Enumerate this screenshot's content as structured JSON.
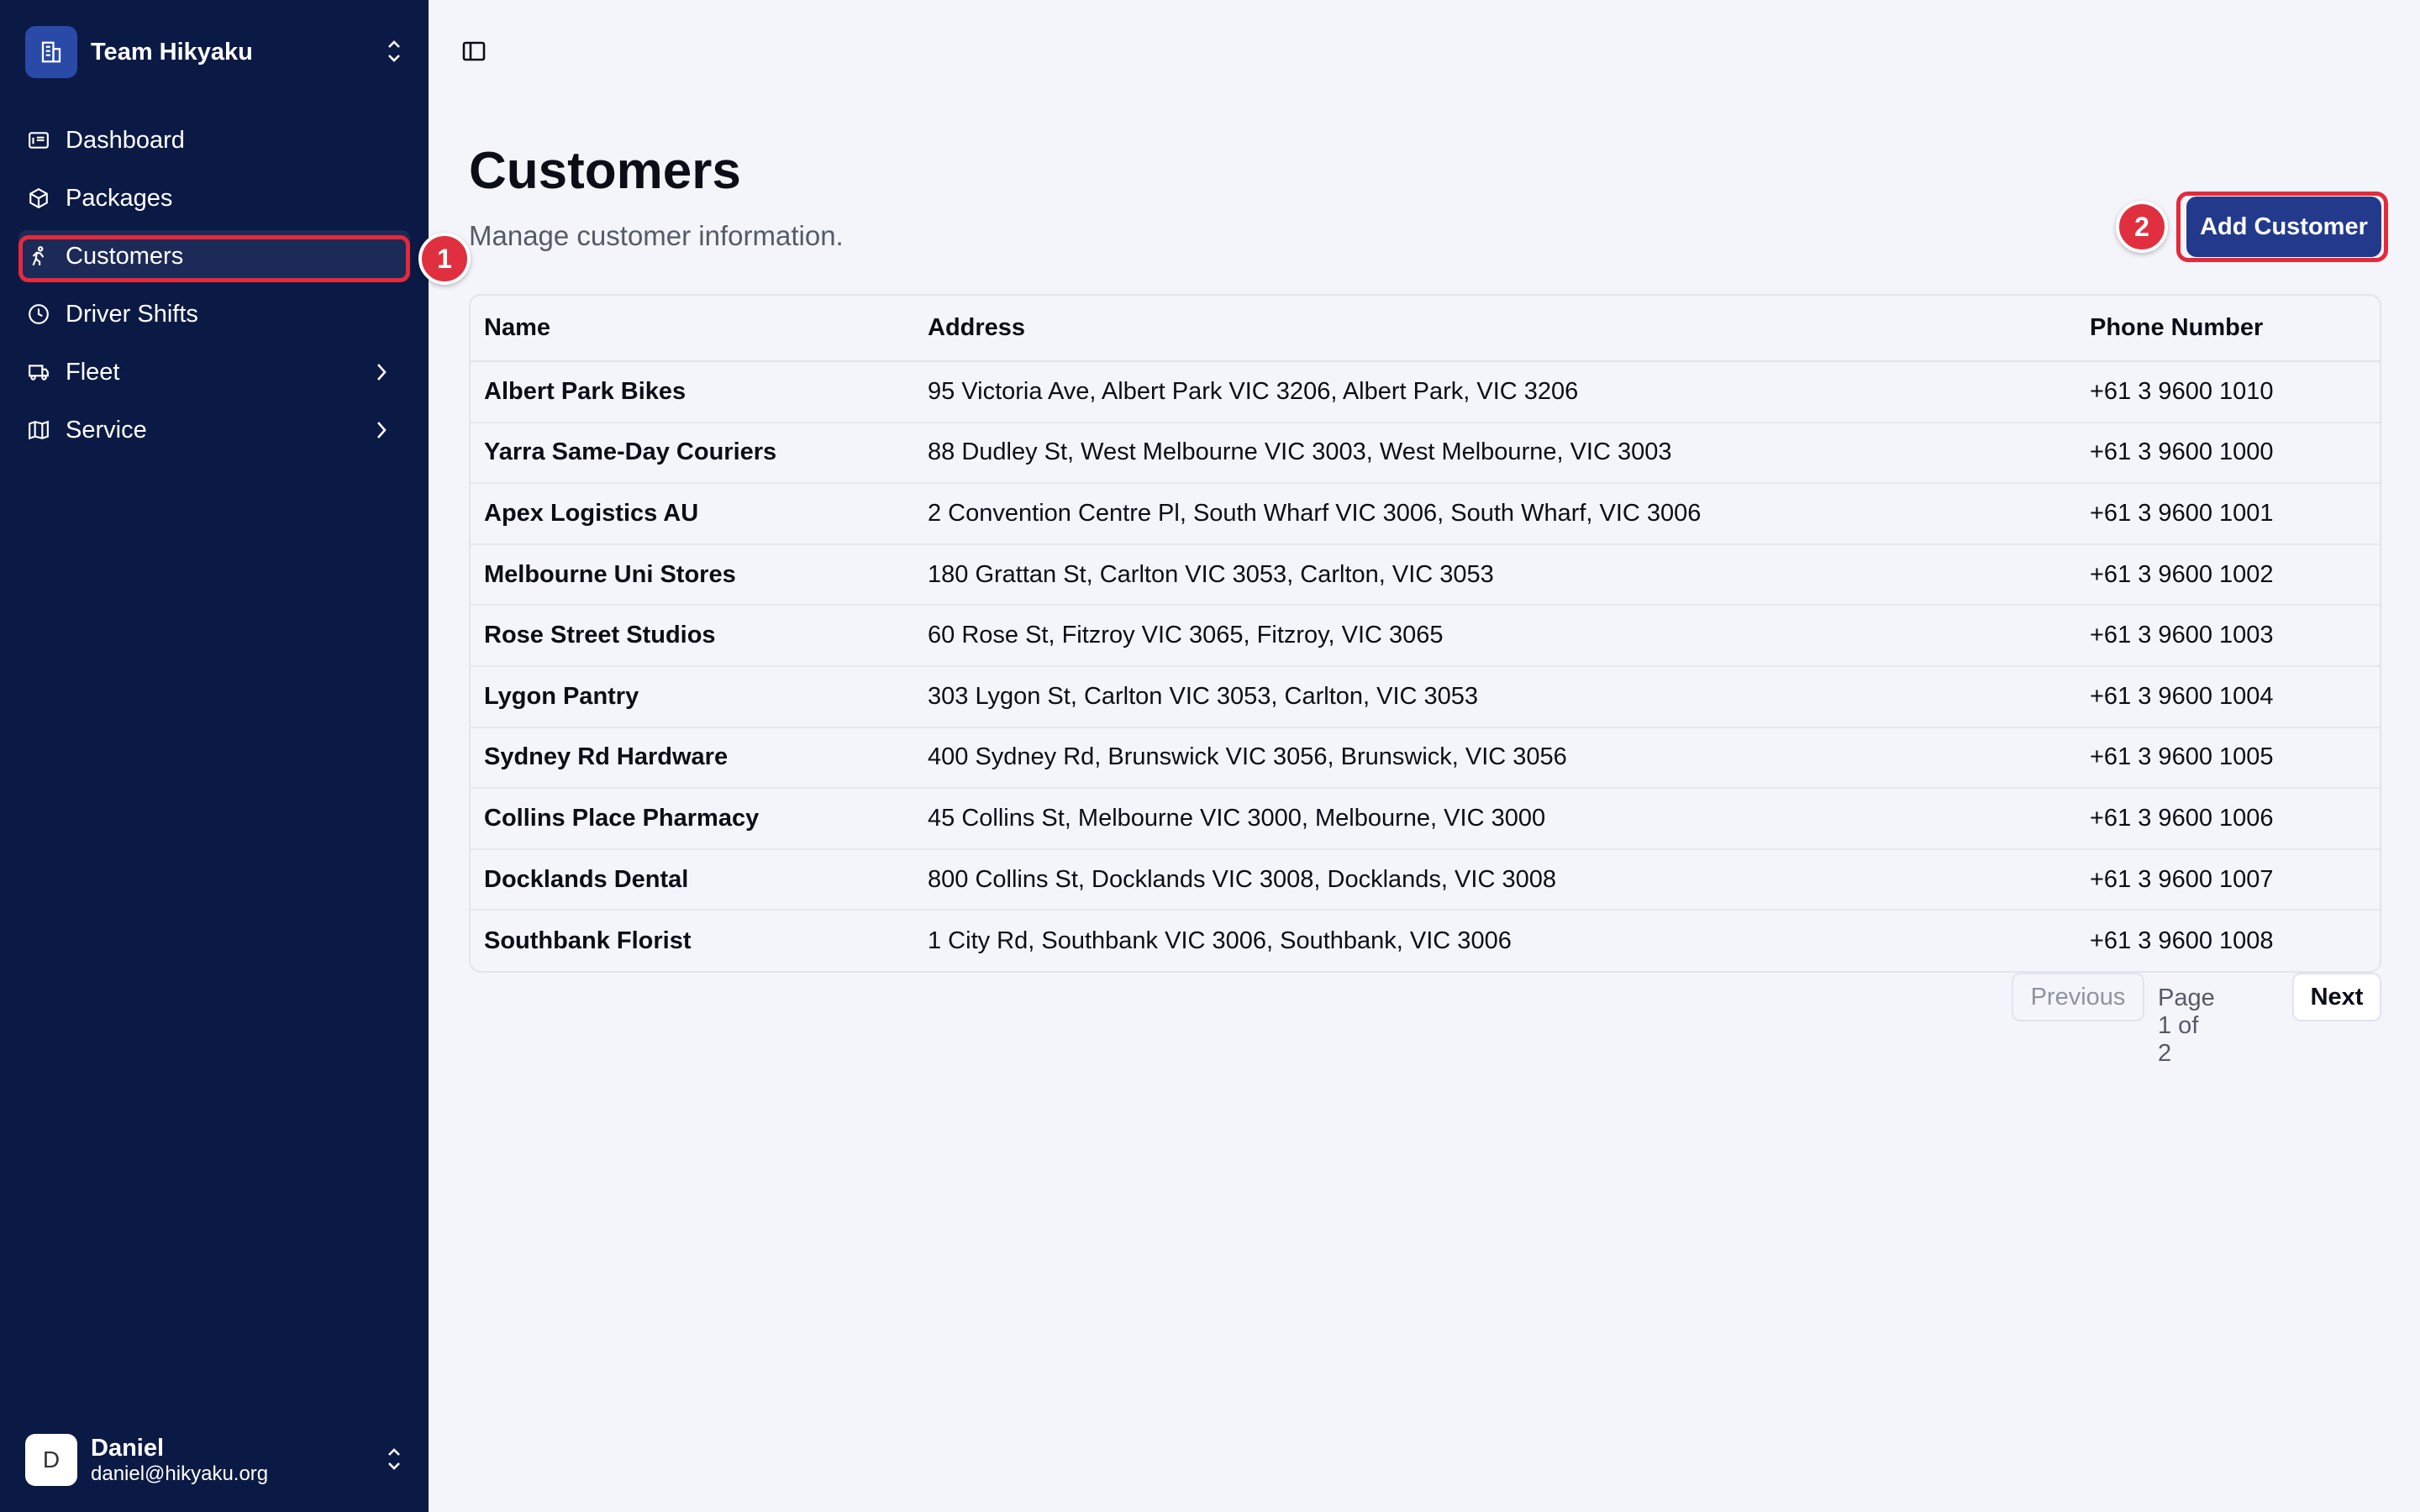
{
  "sidebar": {
    "team_name": "Team Hikyaku",
    "items": [
      {
        "label": "Dashboard",
        "icon": "dashboard-icon"
      },
      {
        "label": "Packages",
        "icon": "package-icon"
      },
      {
        "label": "Customers",
        "icon": "customer-icon",
        "active": true
      },
      {
        "label": "Driver Shifts",
        "icon": "clock-icon"
      },
      {
        "label": "Fleet",
        "icon": "truck-icon",
        "has_submenu": true
      },
      {
        "label": "Service",
        "icon": "map-icon",
        "has_submenu": true
      }
    ],
    "user": {
      "initial": "D",
      "name": "Daniel",
      "email": "daniel@hikyaku.org"
    }
  },
  "annotations": {
    "badge_1": "1",
    "badge_2": "2"
  },
  "page": {
    "title": "Customers",
    "subtitle": "Manage customer information.",
    "add_button_label": "Add Customer"
  },
  "table": {
    "columns": [
      "Name",
      "Address",
      "Phone Number"
    ],
    "rows": [
      {
        "name": "Albert Park Bikes",
        "address": "95 Victoria Ave, Albert Park VIC 3206, Albert Park, VIC 3206",
        "phone": "+61 3 9600 1010"
      },
      {
        "name": "Yarra Same-Day Couriers",
        "address": "88 Dudley St, West Melbourne VIC 3003, West Melbourne, VIC 3003",
        "phone": "+61 3 9600 1000"
      },
      {
        "name": "Apex Logistics AU",
        "address": "2 Convention Centre Pl, South Wharf VIC 3006, South Wharf, VIC 3006",
        "phone": "+61 3 9600 1001"
      },
      {
        "name": "Melbourne Uni Stores",
        "address": "180 Grattan St, Carlton VIC 3053, Carlton, VIC 3053",
        "phone": "+61 3 9600 1002"
      },
      {
        "name": "Rose Street Studios",
        "address": "60 Rose St, Fitzroy VIC 3065, Fitzroy, VIC 3065",
        "phone": "+61 3 9600 1003"
      },
      {
        "name": "Lygon Pantry",
        "address": "303 Lygon St, Carlton VIC 3053, Carlton, VIC 3053",
        "phone": "+61 3 9600 1004"
      },
      {
        "name": "Sydney Rd Hardware",
        "address": "400 Sydney Rd, Brunswick VIC 3056, Brunswick, VIC 3056",
        "phone": "+61 3 9600 1005"
      },
      {
        "name": "Collins Place Pharmacy",
        "address": "45 Collins St, Melbourne VIC 3000, Melbourne, VIC 3000",
        "phone": "+61 3 9600 1006"
      },
      {
        "name": "Docklands Dental",
        "address": "800 Collins St, Docklands VIC 3008, Docklands, VIC 3008",
        "phone": "+61 3 9600 1007"
      },
      {
        "name": "Southbank Florist",
        "address": "1 City Rd, Southbank VIC 3006, Southbank, VIC 3006",
        "phone": "+61 3 9600 1008"
      }
    ]
  },
  "pagination": {
    "previous_label": "Previous",
    "page_info": "Page 1 of 2",
    "next_label": "Next"
  },
  "colors": {
    "sidebar_bg": "#0b1a45",
    "accent": "#233a8c",
    "highlight": "#e5293b",
    "page_bg": "#f4f5fb"
  }
}
